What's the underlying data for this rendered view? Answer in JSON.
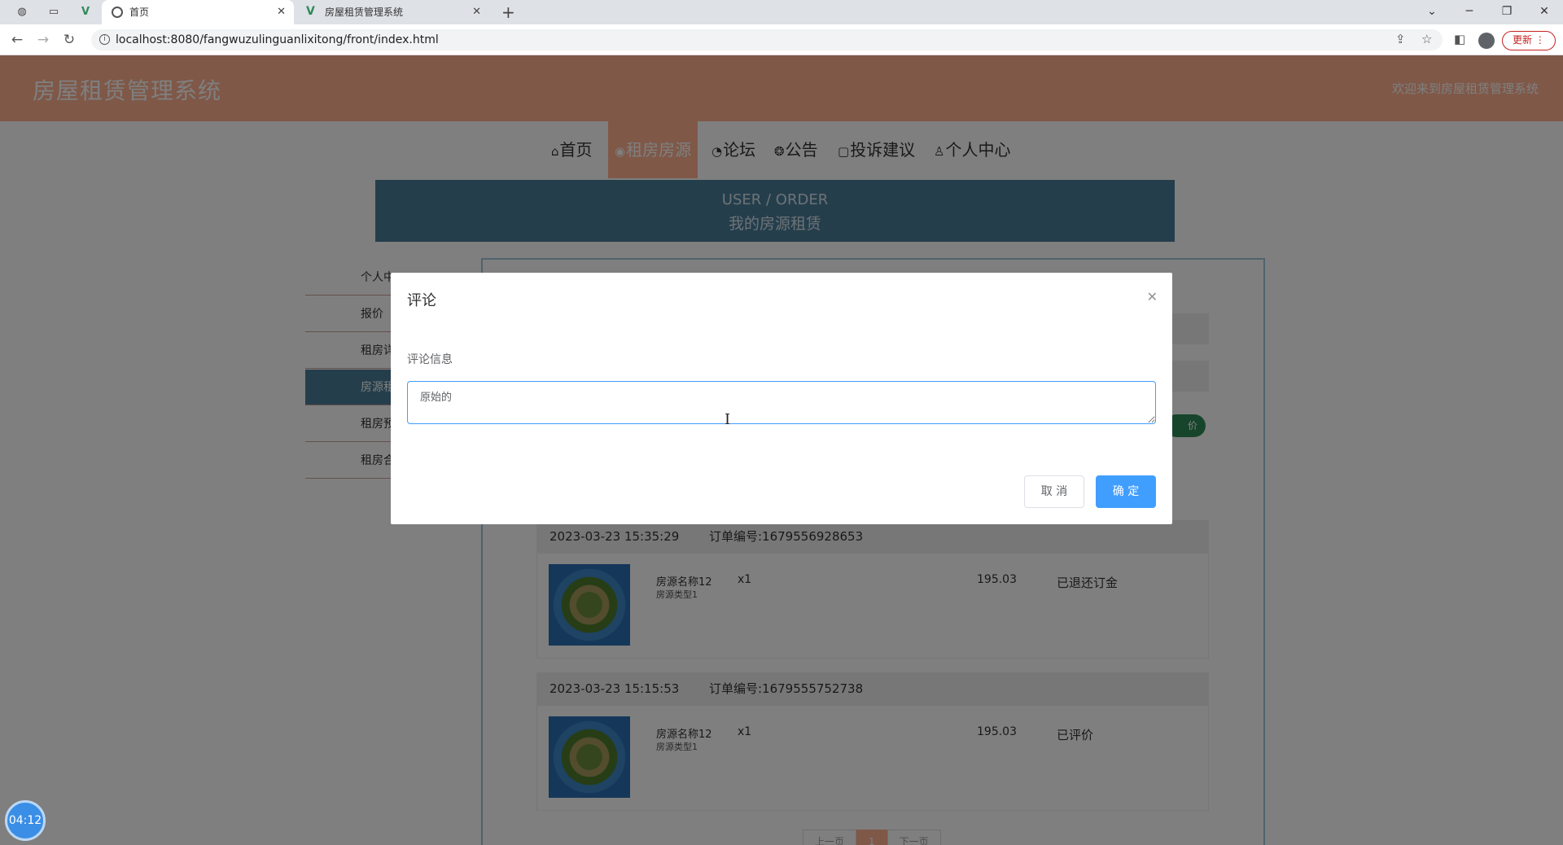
{
  "browser": {
    "tabs": [
      {
        "label": "首页",
        "active": true
      },
      {
        "label": "房屋租赁管理系统",
        "active": false
      }
    ],
    "url": "localhost:8080/fangwuzulinguanlixitong/front/index.html",
    "update_label": "更新"
  },
  "site": {
    "title": "房屋租赁管理系统",
    "welcome": "欢迎来到房屋租赁管理系统"
  },
  "nav": {
    "items": [
      {
        "label": "首页",
        "icon": "home-icon"
      },
      {
        "label": "租房房源",
        "icon": "globe-icon"
      },
      {
        "label": "论坛",
        "icon": "gauge-icon"
      },
      {
        "label": "公告",
        "icon": "palette-icon"
      },
      {
        "label": "投诉建议",
        "icon": "note-icon"
      },
      {
        "label": "个人中心",
        "icon": "user-icon"
      }
    ],
    "active": "租房房源"
  },
  "banner": {
    "en": "USER / ORDER",
    "cn": "我的房源租赁"
  },
  "sidebar": {
    "items": [
      {
        "label": "个人中"
      },
      {
        "label": "报价"
      },
      {
        "label": "租房详"
      },
      {
        "label": "房源租"
      },
      {
        "label": "租房预"
      },
      {
        "label": "租房合"
      }
    ],
    "active": "房源租"
  },
  "orders": [
    {
      "time": "2023-03-23 15:35:29",
      "order_no": "订单编号:1679556928653",
      "name": "房源名称12",
      "type": "房源类型1",
      "qty": "x1",
      "price": "195.03",
      "status": "已退还订金"
    },
    {
      "time": "2023-03-23 15:15:53",
      "order_no": "订单编号:1679555752738",
      "name": "房源名称12",
      "type": "房源类型1",
      "qty": "x1",
      "price": "195.03",
      "status": "已评价"
    }
  ],
  "pagination": {
    "prev": "上一页",
    "current": "1",
    "next": "下一页"
  },
  "eval_button_partial": "价",
  "timer": "04:12",
  "dialog": {
    "title": "评论",
    "field_label": "评论信息",
    "value": "原始的",
    "cancel": "取 消",
    "confirm": "确 定"
  },
  "colors": {
    "header": "#ffb090",
    "banner": "#4a7d98",
    "primary": "#409eff"
  }
}
